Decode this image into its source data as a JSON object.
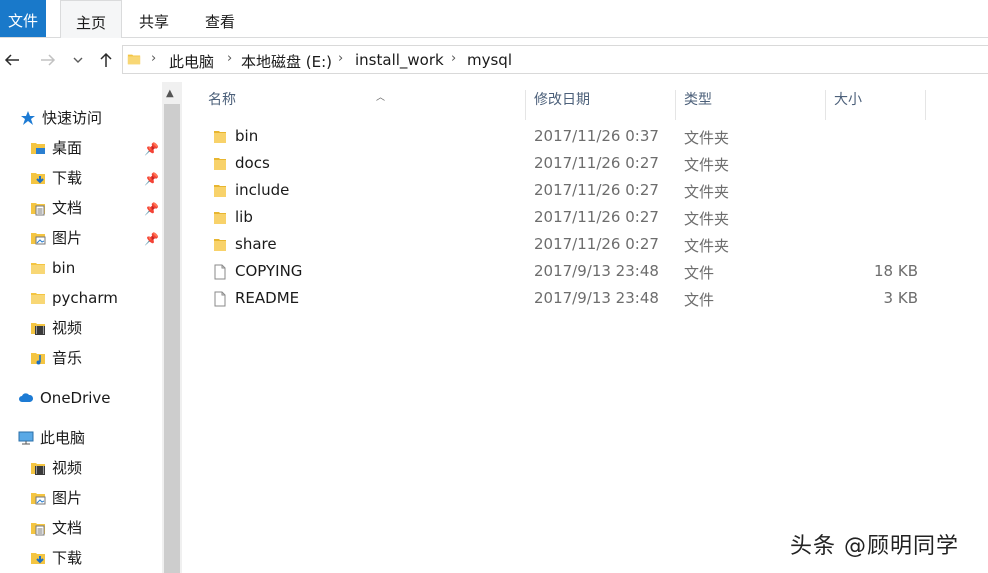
{
  "ribbon": {
    "tabs": [
      {
        "label": "文件"
      },
      {
        "label": "主页"
      },
      {
        "label": "共享"
      },
      {
        "label": "查看"
      }
    ]
  },
  "nav": {
    "back_icon": "arrow-left-icon",
    "forward_icon": "arrow-right-icon",
    "recent_icon": "chevron-down-icon",
    "up_icon": "arrow-up-icon"
  },
  "address": {
    "crumbs": [
      "此电脑",
      "本地磁盘 (E:)",
      "install_work",
      "mysql"
    ],
    "separator": "›"
  },
  "sidebar": {
    "quick_access": "快速访问",
    "pinned": [
      {
        "label": "桌面",
        "icon": "desktop-icon"
      },
      {
        "label": "下载",
        "icon": "download-icon"
      },
      {
        "label": "文档",
        "icon": "document-icon"
      },
      {
        "label": "图片",
        "icon": "picture-icon"
      }
    ],
    "folders": [
      {
        "label": "bin"
      },
      {
        "label": "pycharm"
      },
      {
        "label": "视频"
      },
      {
        "label": "音乐"
      }
    ],
    "onedrive": "OneDrive",
    "this_pc": "此电脑",
    "pc_items": [
      {
        "label": "视频"
      },
      {
        "label": "图片"
      },
      {
        "label": "文档"
      },
      {
        "label": "下载"
      }
    ]
  },
  "columns": {
    "name": "名称",
    "modified": "修改日期",
    "type": "类型",
    "size": "大小"
  },
  "files": [
    {
      "name": "bin",
      "modified": "2017/11/26 0:37",
      "type": "文件夹",
      "size": "",
      "kind": "folder"
    },
    {
      "name": "docs",
      "modified": "2017/11/26 0:27",
      "type": "文件夹",
      "size": "",
      "kind": "folder"
    },
    {
      "name": "include",
      "modified": "2017/11/26 0:27",
      "type": "文件夹",
      "size": "",
      "kind": "folder"
    },
    {
      "name": "lib",
      "modified": "2017/11/26 0:27",
      "type": "文件夹",
      "size": "",
      "kind": "folder"
    },
    {
      "name": "share",
      "modified": "2017/11/26 0:27",
      "type": "文件夹",
      "size": "",
      "kind": "folder"
    },
    {
      "name": "COPYING",
      "modified": "2017/9/13 23:48",
      "type": "文件",
      "size": "18 KB",
      "kind": "file"
    },
    {
      "name": "README",
      "modified": "2017/9/13 23:48",
      "type": "文件",
      "size": "3 KB",
      "kind": "file"
    }
  ],
  "watermark": "头条 @顾明同学",
  "colors": {
    "file_tab": "#1979ca",
    "folder_yellow": "#f4c542",
    "header_text": "#4c607a"
  }
}
